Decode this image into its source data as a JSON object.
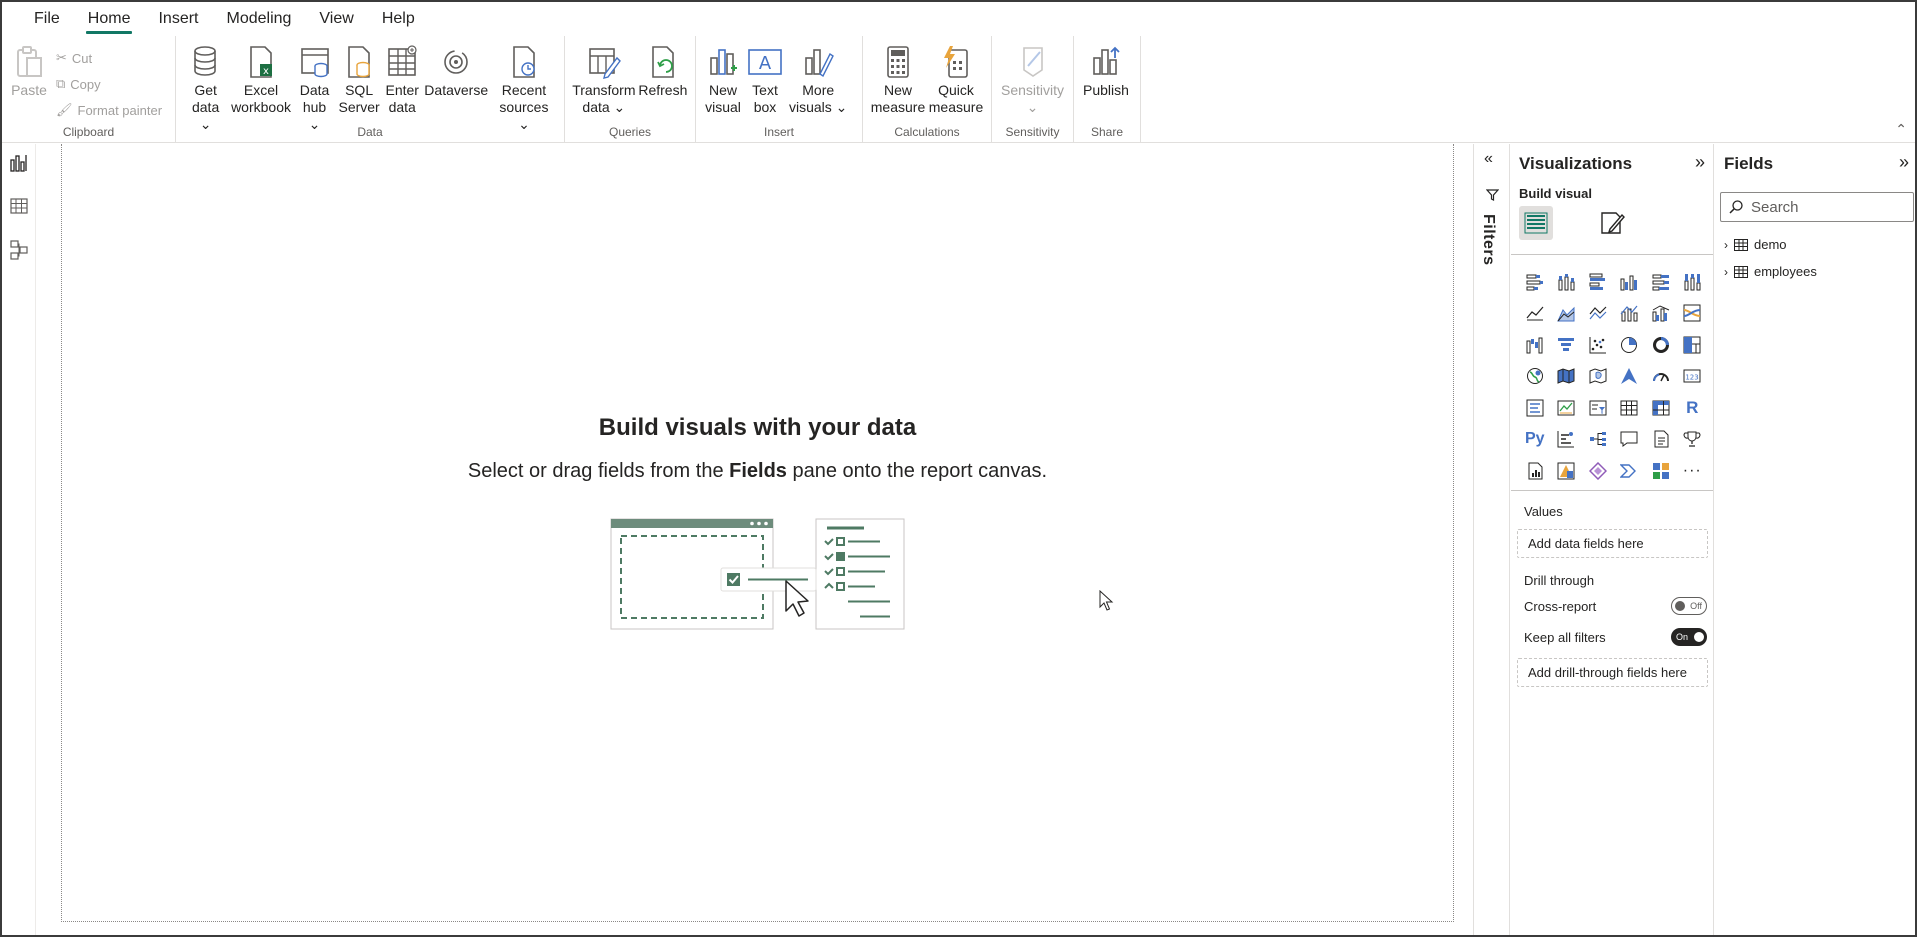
{
  "menu": [
    "File",
    "Home",
    "Insert",
    "Modeling",
    "View",
    "Help"
  ],
  "ribbon": {
    "clipboard": {
      "label": "Clipboard",
      "paste": "Paste",
      "cut": "Cut",
      "copy": "Copy",
      "format_painter": "Format painter"
    },
    "data": {
      "label": "Data",
      "get_data": "Get\ndata ⌄",
      "excel_workbook": "Excel\nworkbook",
      "data_hub": "Data\nhub ⌄",
      "sql_server": "SQL\nServer",
      "enter_data": "Enter\ndata",
      "dataverse": "Dataverse",
      "recent_sources": "Recent\nsources ⌄"
    },
    "queries": {
      "label": "Queries",
      "transform_data": "Transform\ndata ⌄",
      "refresh": "Refresh"
    },
    "insert": {
      "label": "Insert",
      "new_visual": "New\nvisual",
      "text_box": "Text\nbox",
      "more_visuals": "More\nvisuals ⌄"
    },
    "calculations": {
      "label": "Calculations",
      "new_measure": "New\nmeasure",
      "quick_measure": "Quick\nmeasure"
    },
    "sensitivity": {
      "label": "Sensitivity",
      "sensitivity": "Sensitivity\n⌄"
    },
    "share": {
      "label": "Share",
      "publish": "Publish"
    }
  },
  "canvas": {
    "title": "Build visuals with your data",
    "sub_before": "Select or drag fields from the ",
    "sub_bold": "Fields",
    "sub_after": " pane onto the report canvas."
  },
  "filters": {
    "label": "Filters"
  },
  "visualizations": {
    "title": "Visualizations",
    "build_visual": "Build visual",
    "values_label": "Values",
    "values_placeholder": "Add data fields here",
    "drill_through": "Drill through",
    "cross_report": "Cross-report",
    "cross_report_state": "Off",
    "keep_all_filters": "Keep all filters",
    "keep_all_filters_state": "On",
    "drill_placeholder": "Add drill-through fields here"
  },
  "fields": {
    "title": "Fields",
    "search_placeholder": "Search",
    "tables": [
      "demo",
      "employees"
    ]
  },
  "colors": {
    "accent": "#117865",
    "viz_blue": "#4472c4",
    "viz_orange": "#e8a43c"
  }
}
